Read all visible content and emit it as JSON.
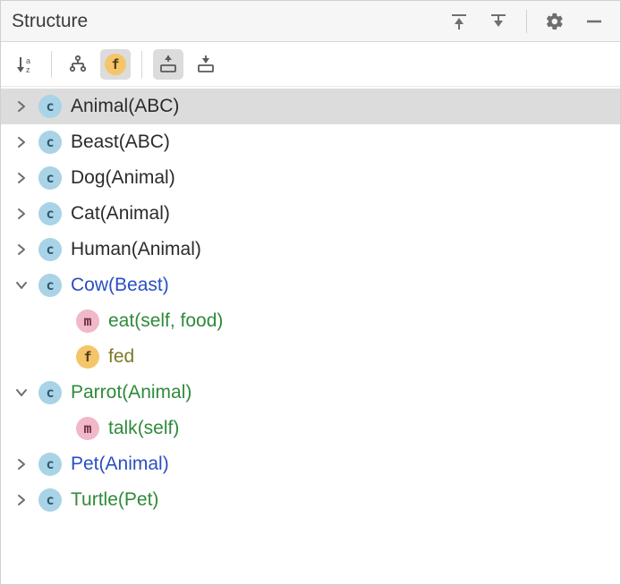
{
  "panel": {
    "title": "Structure"
  },
  "colors": {
    "class_icon_bg": "#a9d3e6",
    "method_icon_bg": "#f0b8c8",
    "field_icon_bg": "#f4c56a",
    "link_blue": "#2a4fc0",
    "link_green": "#2f8a3a",
    "olive": "#7a7a26"
  },
  "icons": {
    "class": "c",
    "method": "m",
    "field": "f"
  },
  "tree": [
    {
      "id": "animal",
      "kind": "class",
      "name": "Animal",
      "paren": "(ABC)",
      "expanded": false,
      "selected": true,
      "color": "default",
      "depth": 0
    },
    {
      "id": "beast",
      "kind": "class",
      "name": "Beast",
      "paren": "(ABC)",
      "expanded": false,
      "selected": false,
      "color": "default",
      "depth": 0
    },
    {
      "id": "dog",
      "kind": "class",
      "name": "Dog",
      "paren": "(Animal)",
      "expanded": false,
      "selected": false,
      "color": "default",
      "depth": 0
    },
    {
      "id": "cat",
      "kind": "class",
      "name": "Cat",
      "paren": "(Animal)",
      "expanded": false,
      "selected": false,
      "color": "default",
      "depth": 0
    },
    {
      "id": "human",
      "kind": "class",
      "name": "Human",
      "paren": "(Animal)",
      "expanded": false,
      "selected": false,
      "color": "default",
      "depth": 0
    },
    {
      "id": "cow",
      "kind": "class",
      "name": "Cow",
      "paren": "(Beast)",
      "expanded": true,
      "selected": false,
      "color": "blue",
      "depth": 0
    },
    {
      "id": "cow-eat",
      "kind": "method",
      "name": "eat",
      "paren": "(self, food)",
      "expanded": null,
      "selected": false,
      "color": "green",
      "depth": 1
    },
    {
      "id": "cow-fed",
      "kind": "field",
      "name": "fed",
      "paren": "",
      "expanded": null,
      "selected": false,
      "color": "olive",
      "depth": 1
    },
    {
      "id": "parrot",
      "kind": "class",
      "name": "Parrot",
      "paren": "(Animal)",
      "expanded": true,
      "selected": false,
      "color": "green",
      "depth": 0
    },
    {
      "id": "parrot-talk",
      "kind": "method",
      "name": "talk",
      "paren": "(self)",
      "expanded": null,
      "selected": false,
      "color": "green",
      "depth": 1
    },
    {
      "id": "pet",
      "kind": "class",
      "name": "Pet",
      "paren": "(Animal)",
      "expanded": false,
      "selected": false,
      "color": "blue",
      "depth": 0
    },
    {
      "id": "turtle",
      "kind": "class",
      "name": "Turtle",
      "paren": "(Pet)",
      "expanded": false,
      "selected": false,
      "color": "green",
      "depth": 0
    }
  ]
}
